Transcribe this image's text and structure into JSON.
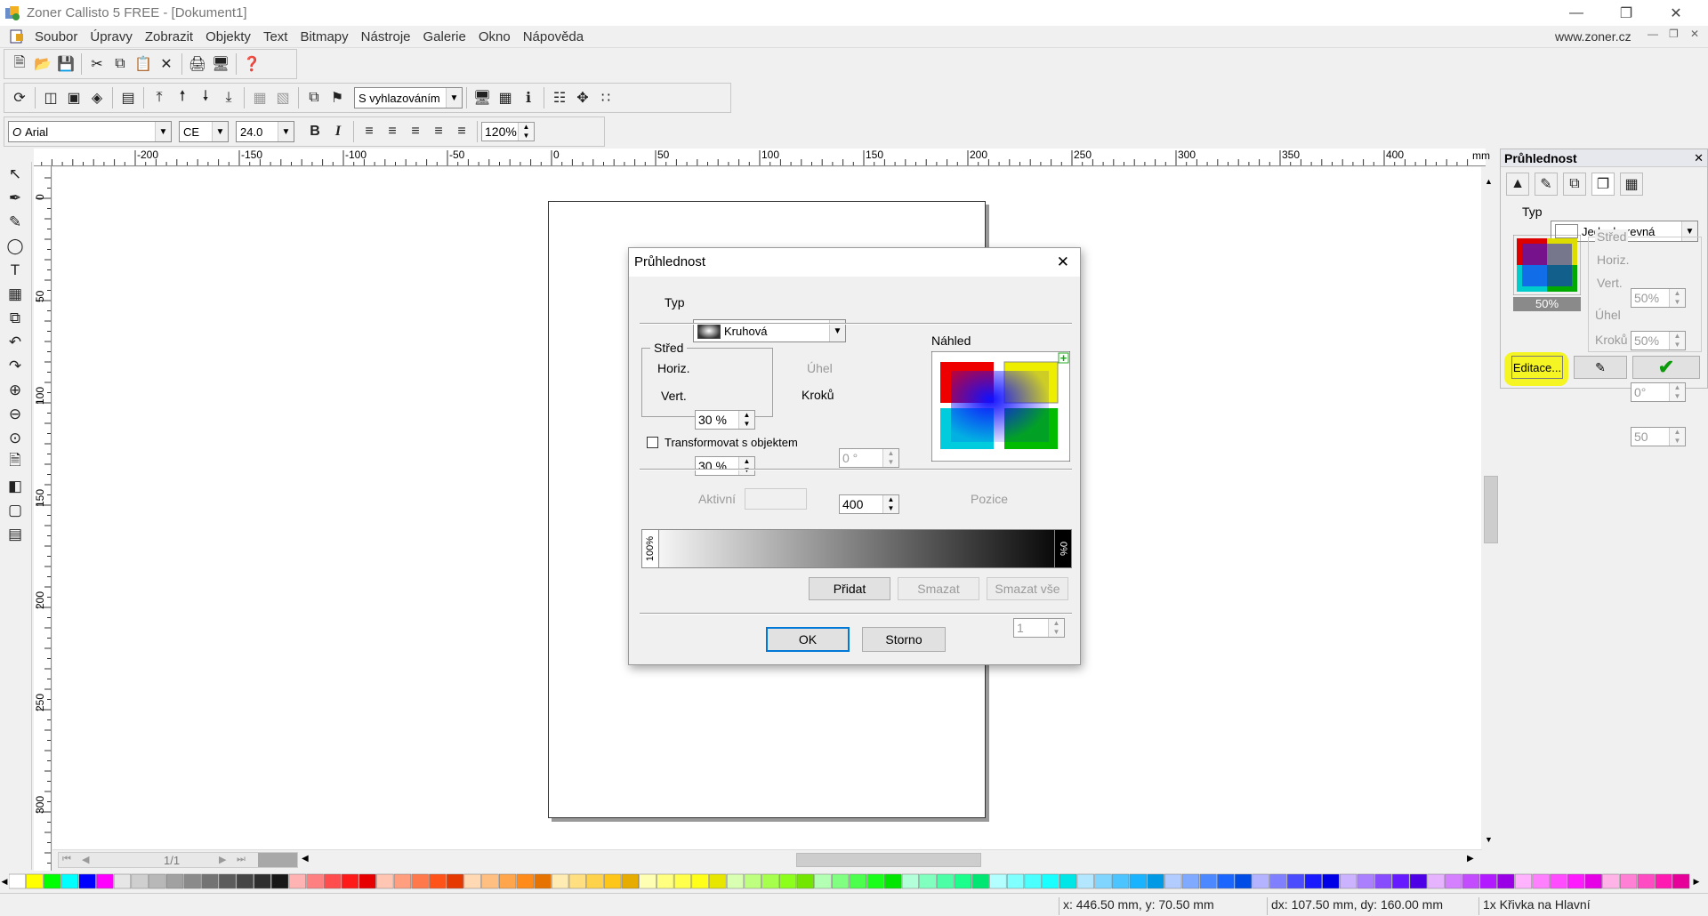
{
  "window": {
    "title": "Zoner Callisto 5 FREE - [Dokument1]",
    "url": "www.zoner.cz"
  },
  "menu": [
    "Soubor",
    "Úpravy",
    "Zobrazit",
    "Objekty",
    "Text",
    "Bitmapy",
    "Nástroje",
    "Galerie",
    "Okno",
    "Nápověda"
  ],
  "toolbar": {
    "smoothing": "S vyhlazováním"
  },
  "format": {
    "font": "Arial",
    "charset": "CE",
    "size": "24.0",
    "zoom": "120%",
    "bold": "B",
    "italic": "I"
  },
  "ruler": {
    "unit": "mm",
    "h_labels": [
      "-200",
      "-150",
      "-100",
      "-50",
      "0",
      "50",
      "100",
      "150",
      "200",
      "250",
      "300",
      "350",
      "400"
    ],
    "v_labels": [
      "0",
      "50",
      "100",
      "150",
      "200",
      "250",
      "300"
    ]
  },
  "hscroll": {
    "page": "1/1"
  },
  "panel": {
    "title": "Průhlednost",
    "type_label": "Typ",
    "type_value": "Jednobarevná",
    "center_label": "Střed",
    "horiz_label": "Horiz.",
    "horiz_value": "50%",
    "vert_label": "Vert.",
    "vert_value": "50%",
    "angle_label": "Úhel",
    "angle_value": "0°",
    "steps_label": "Kroků",
    "steps_value": "50",
    "preview_percent": "50%",
    "edit_button": "Editace..."
  },
  "dialog": {
    "title": "Průhlednost",
    "type_label": "Typ",
    "type_value": "Kruhová",
    "center_label": "Střed",
    "horiz_label": "Horiz.",
    "horiz_value": "30 %",
    "vert_label": "Vert.",
    "vert_value": "30 %",
    "angle_label": "Úhel",
    "angle_value": "0 °",
    "steps_label": "Kroků",
    "steps_value": "400",
    "preview_label": "Náhled",
    "transform_label": "Transformovat s objektem",
    "active_label": "Aktivní",
    "position_label": "Pozice",
    "position_value": "1",
    "grad_start": "100%",
    "grad_end": "0%",
    "add_button": "Přidat",
    "delete_button": "Smazat",
    "delete_all_button": "Smazat vše",
    "ok_button": "OK",
    "cancel_button": "Storno"
  },
  "status": {
    "cursor": "x: 446.50 mm, y: 70.50 mm",
    "delta": "dx: 107.50 mm, dy: 160.00 mm",
    "selection": "1x Křivka na Hlavní"
  }
}
